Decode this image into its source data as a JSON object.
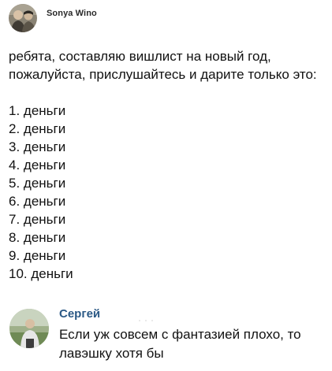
{
  "post": {
    "author": {
      "name": "Sonya Wino",
      "avatar_icon": "user-avatar-photo"
    },
    "text": {
      "intro": "ребята, составляю вишлист на новый год, пожалуйста, прислушайтесь и дарите только это:",
      "list": [
        "1. деньги",
        "2. деньги",
        "3. деньги",
        "4. деньги",
        "5. деньги",
        "6. деньги",
        "7. деньги",
        "8. деньги",
        "9. деньги",
        "10. деньги"
      ]
    }
  },
  "comment": {
    "author": "Сергей",
    "avatar_icon": "user-avatar-photo",
    "text": "Если уж совсем с фантазией плохо, то лавэшку хотя бы"
  },
  "colors": {
    "comment_author": "#2a5885",
    "text": "#111111",
    "background": "#ffffff"
  }
}
